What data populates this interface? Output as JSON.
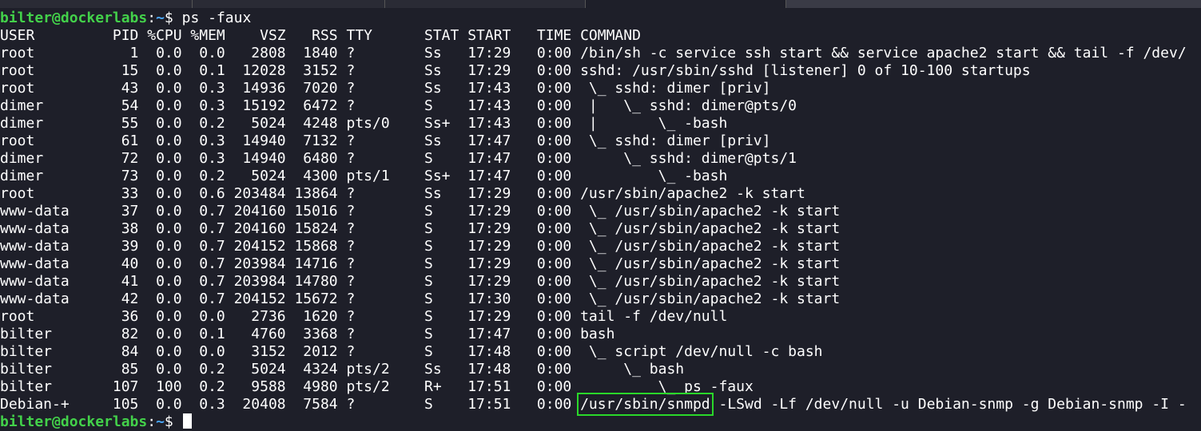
{
  "prompt": {
    "user_host": "bilter@dockerlabs",
    "sep": ":",
    "path": "~",
    "dollar": "$ ",
    "command": "ps -faux"
  },
  "header": "USER         PID %CPU %MEM    VSZ   RSS TTY      STAT START   TIME COMMAND",
  "rows": [
    "root           1  0.0  0.0   2808  1840 ?        Ss   17:29   0:00 /bin/sh -c service ssh start && service apache2 start && tail -f /dev/",
    "root          15  0.0  0.1  12028  3152 ?        Ss   17:29   0:00 sshd: /usr/sbin/sshd [listener] 0 of 10-100 startups",
    "root          43  0.0  0.3  14936  7020 ?        Ss   17:43   0:00  \\_ sshd: dimer [priv]",
    "dimer         54  0.0  0.3  15192  6472 ?        S    17:43   0:00  |   \\_ sshd: dimer@pts/0",
    "dimer         55  0.0  0.2   5024  4248 pts/0    Ss+  17:43   0:00  |       \\_ -bash",
    "root          61  0.0  0.3  14940  7132 ?        Ss   17:47   0:00  \\_ sshd: dimer [priv]",
    "dimer         72  0.0  0.3  14940  6480 ?        S    17:47   0:00      \\_ sshd: dimer@pts/1",
    "dimer         73  0.0  0.2   5024  4300 pts/1    Ss+  17:47   0:00          \\_ -bash",
    "root          33  0.0  0.6 203484 13864 ?        Ss   17:29   0:00 /usr/sbin/apache2 -k start",
    "www-data      37  0.0  0.7 204160 15016 ?        S    17:29   0:00  \\_ /usr/sbin/apache2 -k start",
    "www-data      38  0.0  0.7 204160 15824 ?        S    17:29   0:00  \\_ /usr/sbin/apache2 -k start",
    "www-data      39  0.0  0.7 204152 15868 ?        S    17:29   0:00  \\_ /usr/sbin/apache2 -k start",
    "www-data      40  0.0  0.7 203984 14716 ?        S    17:29   0:00  \\_ /usr/sbin/apache2 -k start",
    "www-data      41  0.0  0.7 203984 14780 ?        S    17:29   0:00  \\_ /usr/sbin/apache2 -k start",
    "www-data      42  0.0  0.7 204152 15672 ?        S    17:30   0:00  \\_ /usr/sbin/apache2 -k start",
    "root          36  0.0  0.0   2736  1620 ?        S    17:29   0:00 tail -f /dev/null",
    "bilter        82  0.0  0.1   4760  3368 ?        S    17:47   0:00 bash",
    "bilter        84  0.0  0.0   3152  2012 ?        S    17:48   0:00  \\_ script /dev/null -c bash",
    "bilter        85  0.0  0.2   5024  4324 pts/2    Ss   17:48   0:00      \\_ bash",
    "bilter       107  100  0.2   9588  4980 pts/2    R+   17:51   0:00          \\_ ps -faux"
  ],
  "last_row": {
    "prefix": "Debian-+     105  0.0  0.3  20408  7584 ?        S    17:51   0:00 ",
    "highlight": "/usr/sbin/snmpd",
    "suffix": " -LSwd -Lf /dev/null -u Debian-snmp -g Debian-snmp -I -"
  },
  "final_prompt": {
    "user_host": "bilter@dockerlabs",
    "sep": ":",
    "path": "~",
    "dollar": "$ "
  },
  "colors": {
    "background": "#1e1f29",
    "user_host": "#43d14a",
    "path": "#4aa8ff",
    "highlight_box": "#2ad82a"
  }
}
